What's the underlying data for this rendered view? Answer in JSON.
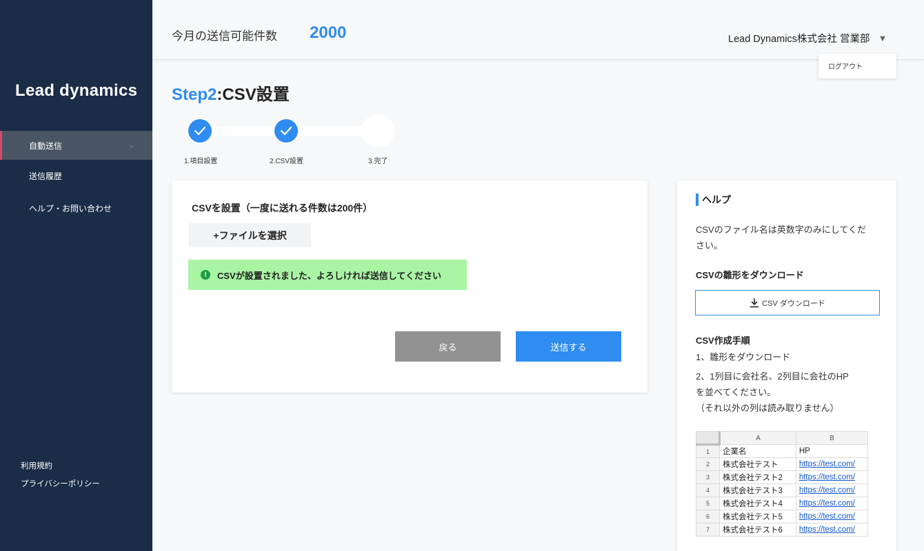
{
  "sidebar": {
    "logo": "Lead dynamics",
    "items": [
      {
        "label": "自動送信"
      },
      {
        "label": "送信履歴"
      },
      {
        "label": "ヘルプ・お問い合わせ"
      }
    ],
    "footer": [
      {
        "label": "利用規約"
      },
      {
        "label": "プライバシーポリシー"
      }
    ]
  },
  "header": {
    "quota_label": "今月の送信可能件数",
    "quota_value": "2000",
    "company": "Lead Dynamics株式会社 営業部",
    "dropdown_item": "ログアウト"
  },
  "main": {
    "title_step": "Step2",
    "title_rest": ":CSV設置",
    "steps": [
      {
        "label": "1.項目設置",
        "status": "done"
      },
      {
        "label": "2.CSV設置",
        "status": "done"
      },
      {
        "label": "3.完了",
        "status": "pending"
      }
    ],
    "card": {
      "title": "CSVを設置（一度に送れる件数は200件）",
      "file_button": "+ファイルを選択",
      "alert_icon": "!",
      "alert": "CSVが設置されました、よろしければ送信してください",
      "back_button": "戻る",
      "send_button": "送信する"
    }
  },
  "help": {
    "title": "ヘルプ",
    "filename_note_1": "CSVのファイル名は英数字のみにしてくだ",
    "filename_note_2": "さい。",
    "template_heading": "CSVの雛形をダウンロード",
    "download_button": "CSV ダウンロード",
    "steps_heading": "CSV作成手順",
    "step1": "1、雛形をダウンロード",
    "step2a": "2、1列目に会社名、2列目に会社のHP",
    "step2b": "を並べてください。",
    "step2c": "（それ以外の列は読み取りません）",
    "sheet": {
      "col_a": "A",
      "col_b": "B",
      "rows": [
        {
          "n": "1",
          "a": "企業名",
          "b": "HP"
        },
        {
          "n": "2",
          "a": "株式会社テスト",
          "b": "https://test.com/"
        },
        {
          "n": "3",
          "a": "株式会社テスト2",
          "b": "https://test.com/"
        },
        {
          "n": "4",
          "a": "株式会社テスト3",
          "b": "https://test.com/"
        },
        {
          "n": "5",
          "a": "株式会社テスト4",
          "b": "https://test.com/"
        },
        {
          "n": "6",
          "a": "株式会社テスト5",
          "b": "https://test.com/"
        },
        {
          "n": "7",
          "a": "株式会社テスト6",
          "b": "https://test.com/"
        }
      ]
    }
  },
  "colors": {
    "accent": "#2f8cf0",
    "sidebar_bg": "#1b2c47",
    "active_marker": "#d24c6a",
    "success_bg": "#a9f5a4",
    "success_icon": "#1ea046",
    "back_button": "#929292"
  }
}
